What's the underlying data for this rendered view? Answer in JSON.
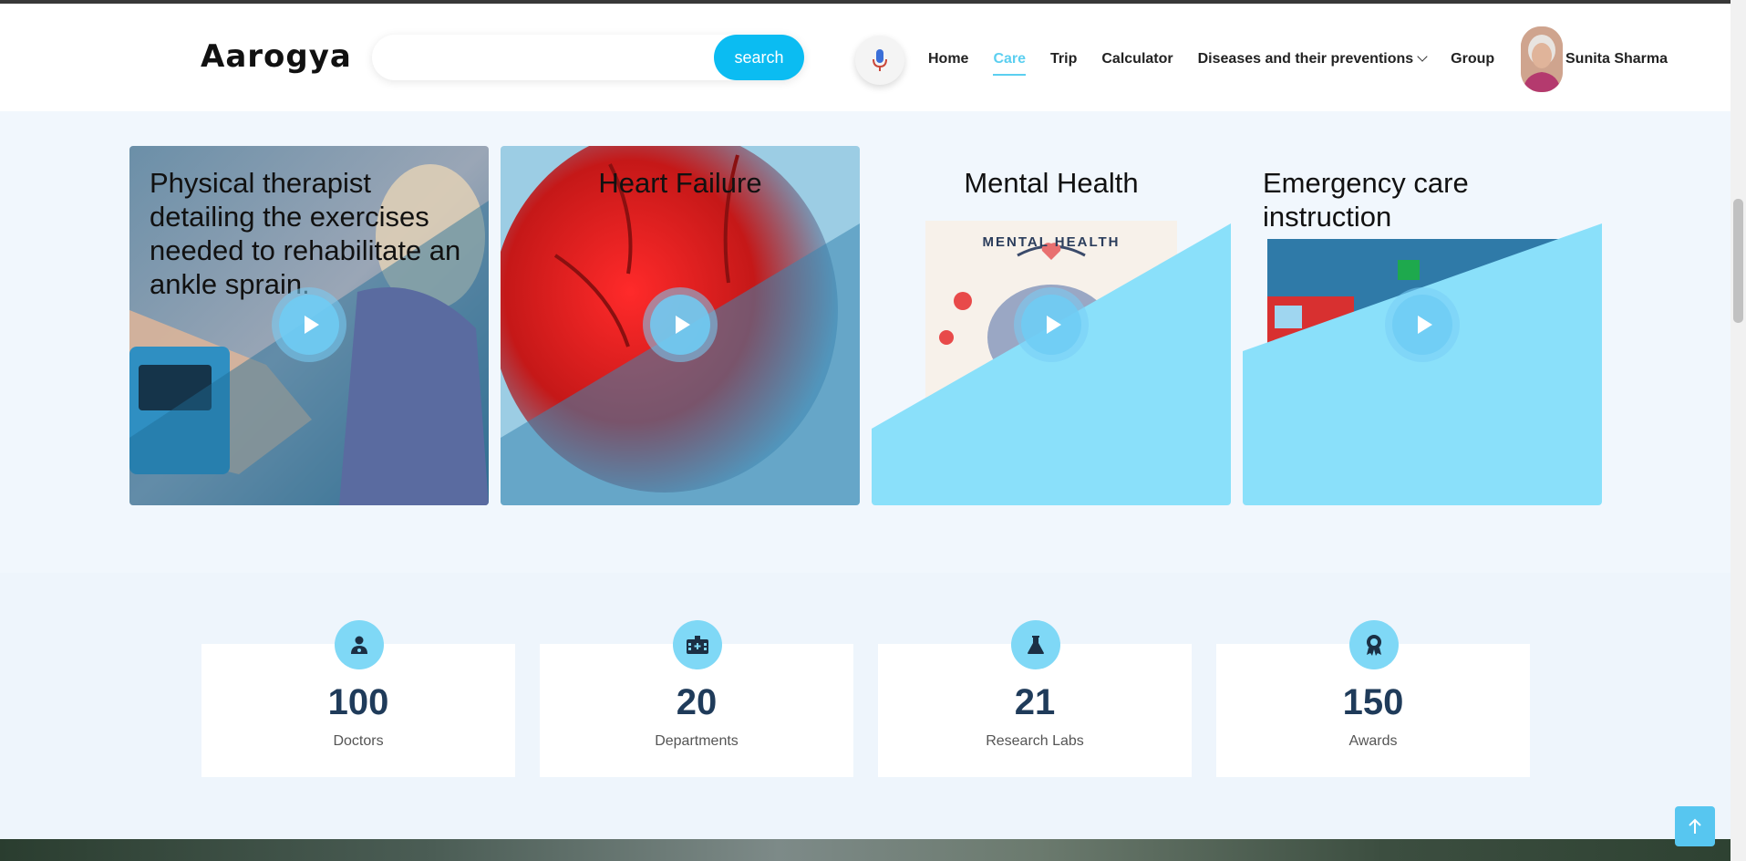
{
  "header": {
    "logo": "Aarogya",
    "search_placeholder": "",
    "search_button": "search",
    "nav": [
      {
        "label": "Home",
        "active": false
      },
      {
        "label": "Care",
        "active": true
      },
      {
        "label": "Trip",
        "active": false
      },
      {
        "label": "Calculator",
        "active": false
      },
      {
        "label": "Diseases and their preventions",
        "active": false,
        "dropdown": true
      },
      {
        "label": "Group",
        "active": false
      }
    ],
    "user_name": "Sunita Sharma"
  },
  "videos": [
    {
      "title": "Physical therapist detailing the exercises needed to rehabilitate an ankle sprain."
    },
    {
      "title": "Heart Failure"
    },
    {
      "title": "Mental Health",
      "image_caption": "MENTAL HEALTH"
    },
    {
      "title": "Emergency care instruction"
    }
  ],
  "stats": [
    {
      "value": "100",
      "label": "Doctors",
      "icon": "doctor-icon"
    },
    {
      "value": "20",
      "label": "Departments",
      "icon": "hospital-icon"
    },
    {
      "value": "21",
      "label": "Research Labs",
      "icon": "flask-icon"
    },
    {
      "value": "150",
      "label": "Awards",
      "icon": "award-icon"
    }
  ],
  "colors": {
    "accent": "#0bbcf2",
    "light_accent": "#8ae0fa",
    "nav_active": "#5ccff0",
    "stat_number": "#1f3b5a"
  }
}
